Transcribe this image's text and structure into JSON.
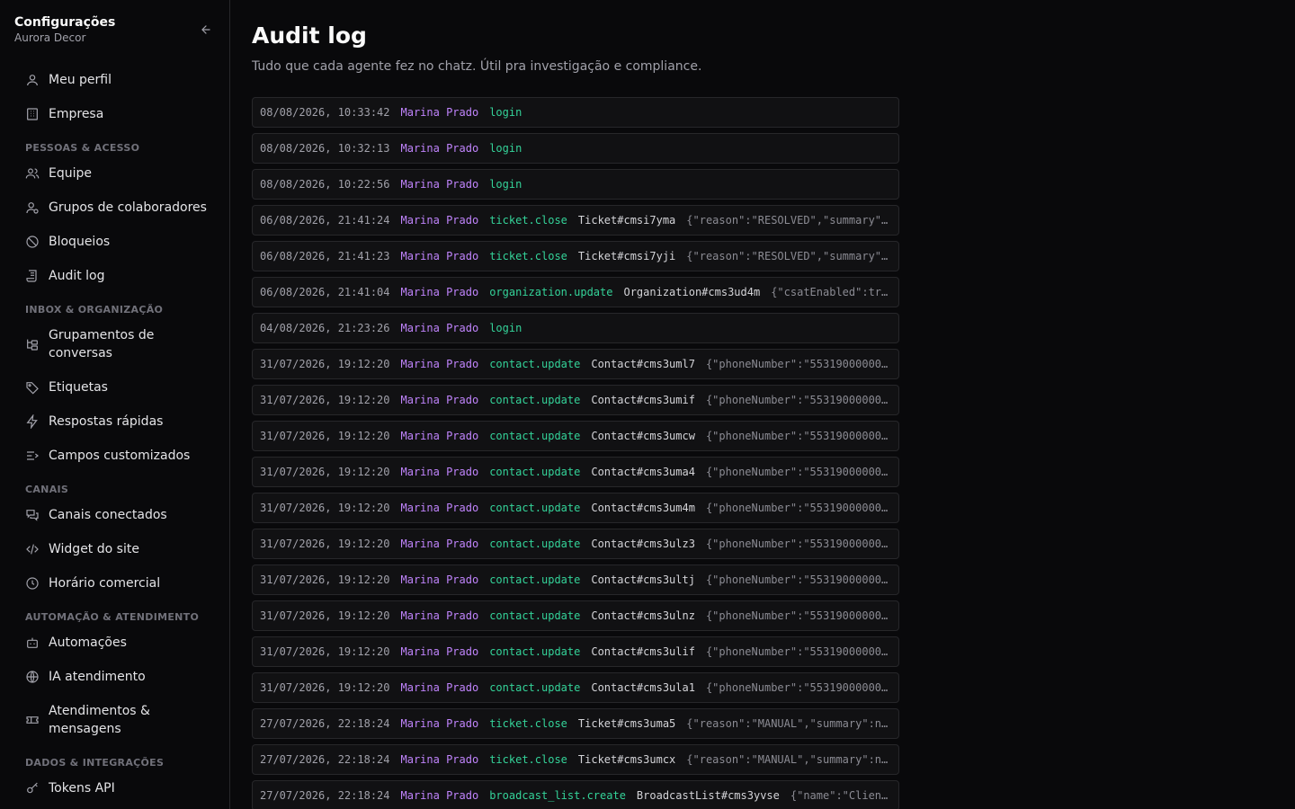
{
  "sidebar": {
    "title": "Configurações",
    "subtitle": "Aurora Decor",
    "items": {
      "perfil": "Meu perfil",
      "empresa": "Empresa",
      "sec_pessoas": "PESSOAS & ACESSO",
      "equipe": "Equipe",
      "grupos": "Grupos de colaboradores",
      "bloqueios": "Bloqueios",
      "audit": "Audit log",
      "sec_inbox": "INBOX & ORGANIZAÇÃO",
      "grupamentos": "Grupamentos de conversas",
      "etiquetas": "Etiquetas",
      "respostas": "Respostas rápidas",
      "campos": "Campos customizados",
      "sec_canais": "CANAIS",
      "canais": "Canais conectados",
      "widget": "Widget do site",
      "horario": "Horário comercial",
      "sec_automacao": "AUTOMAÇÃO & ATENDIMENTO",
      "automacoes": "Automações",
      "ia": "IA atendimento",
      "atendimentos": "Atendimentos & mensagens",
      "sec_dados": "DADOS & INTEGRAÇÕES",
      "tokens": "Tokens API"
    }
  },
  "main": {
    "title": "Audit log",
    "description": "Tudo que cada agente fez no chatz. Útil pra investigação e compliance."
  },
  "logs": [
    {
      "ts": "08/08/2026, 10:33:42",
      "actor": "Marina Prado",
      "action": "login",
      "target": "",
      "payload": ""
    },
    {
      "ts": "08/08/2026, 10:32:13",
      "actor": "Marina Prado",
      "action": "login",
      "target": "",
      "payload": ""
    },
    {
      "ts": "08/08/2026, 10:22:56",
      "actor": "Marina Prado",
      "action": "login",
      "target": "",
      "payload": ""
    },
    {
      "ts": "06/08/2026, 21:41:24",
      "actor": "Marina Prado",
      "action": "ticket.close",
      "target": "Ticket#cmsi7yma",
      "payload": "{\"reason\":\"RESOLVED\",\"summary\"…"
    },
    {
      "ts": "06/08/2026, 21:41:23",
      "actor": "Marina Prado",
      "action": "ticket.close",
      "target": "Ticket#cmsi7yji",
      "payload": "{\"reason\":\"RESOLVED\",\"summary\"…"
    },
    {
      "ts": "06/08/2026, 21:41:04",
      "actor": "Marina Prado",
      "action": "organization.update",
      "target": "Organization#cms3ud4m",
      "payload": "{\"csatEnabled\":tr…"
    },
    {
      "ts": "04/08/2026, 21:23:26",
      "actor": "Marina Prado",
      "action": "login",
      "target": "",
      "payload": ""
    },
    {
      "ts": "31/07/2026, 19:12:20",
      "actor": "Marina Prado",
      "action": "contact.update",
      "target": "Contact#cms3uml7",
      "payload": "{\"phoneNumber\":\"55319000000…"
    },
    {
      "ts": "31/07/2026, 19:12:20",
      "actor": "Marina Prado",
      "action": "contact.update",
      "target": "Contact#cms3umif",
      "payload": "{\"phoneNumber\":\"55319000000…"
    },
    {
      "ts": "31/07/2026, 19:12:20",
      "actor": "Marina Prado",
      "action": "contact.update",
      "target": "Contact#cms3umcw",
      "payload": "{\"phoneNumber\":\"55319000000…"
    },
    {
      "ts": "31/07/2026, 19:12:20",
      "actor": "Marina Prado",
      "action": "contact.update",
      "target": "Contact#cms3uma4",
      "payload": "{\"phoneNumber\":\"55319000000…"
    },
    {
      "ts": "31/07/2026, 19:12:20",
      "actor": "Marina Prado",
      "action": "contact.update",
      "target": "Contact#cms3um4m",
      "payload": "{\"phoneNumber\":\"55319000000…"
    },
    {
      "ts": "31/07/2026, 19:12:20",
      "actor": "Marina Prado",
      "action": "contact.update",
      "target": "Contact#cms3ulz3",
      "payload": "{\"phoneNumber\":\"55319000000…"
    },
    {
      "ts": "31/07/2026, 19:12:20",
      "actor": "Marina Prado",
      "action": "contact.update",
      "target": "Contact#cms3ultj",
      "payload": "{\"phoneNumber\":\"55319000000…"
    },
    {
      "ts": "31/07/2026, 19:12:20",
      "actor": "Marina Prado",
      "action": "contact.update",
      "target": "Contact#cms3ulnz",
      "payload": "{\"phoneNumber\":\"55319000000…"
    },
    {
      "ts": "31/07/2026, 19:12:20",
      "actor": "Marina Prado",
      "action": "contact.update",
      "target": "Contact#cms3ulif",
      "payload": "{\"phoneNumber\":\"55319000000…"
    },
    {
      "ts": "31/07/2026, 19:12:20",
      "actor": "Marina Prado",
      "action": "contact.update",
      "target": "Contact#cms3ula1",
      "payload": "{\"phoneNumber\":\"55319000000…"
    },
    {
      "ts": "27/07/2026, 22:18:24",
      "actor": "Marina Prado",
      "action": "ticket.close",
      "target": "Ticket#cms3uma5",
      "payload": "{\"reason\":\"MANUAL\",\"summary\":n…"
    },
    {
      "ts": "27/07/2026, 22:18:24",
      "actor": "Marina Prado",
      "action": "ticket.close",
      "target": "Ticket#cms3umcx",
      "payload": "{\"reason\":\"MANUAL\",\"summary\":n…"
    },
    {
      "ts": "27/07/2026, 22:18:24",
      "actor": "Marina Prado",
      "action": "broadcast_list.create",
      "target": "BroadcastList#cms3yvse",
      "payload": "{\"name\":\"Clien…"
    }
  ]
}
